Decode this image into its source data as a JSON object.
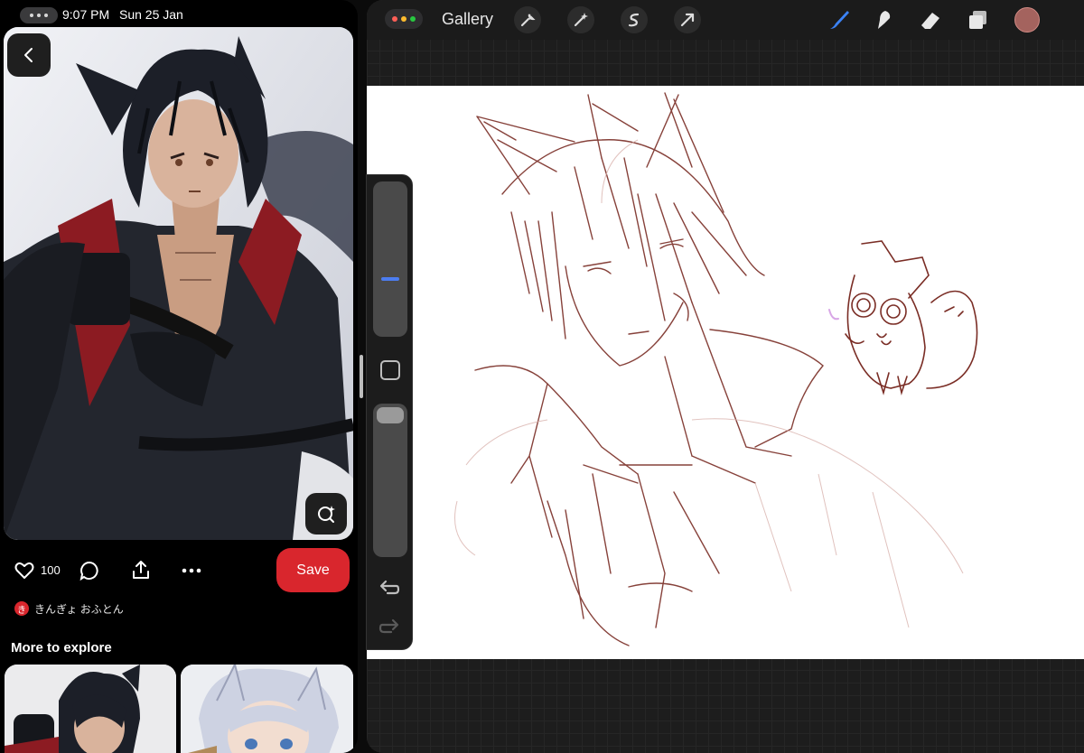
{
  "status_bar": {
    "time": "9:07 PM",
    "date": "Sun 25 Jan"
  },
  "pin": {
    "like_count": "100",
    "save_label": "Save",
    "author_initial": "き",
    "author_name": "きんぎょ おふとん",
    "more_to_explore": "More to explore"
  },
  "procreate": {
    "gallery_label": "Gallery",
    "icons": [
      "wrench-icon",
      "magic-wand-icon",
      "selection-icon",
      "transform-arrow-icon",
      "brush-icon",
      "smudge-icon",
      "eraser-icon",
      "layers-icon",
      "color-swatch-icon"
    ],
    "current_color": "#a4635e",
    "stroke_color": "#7a2d25"
  }
}
